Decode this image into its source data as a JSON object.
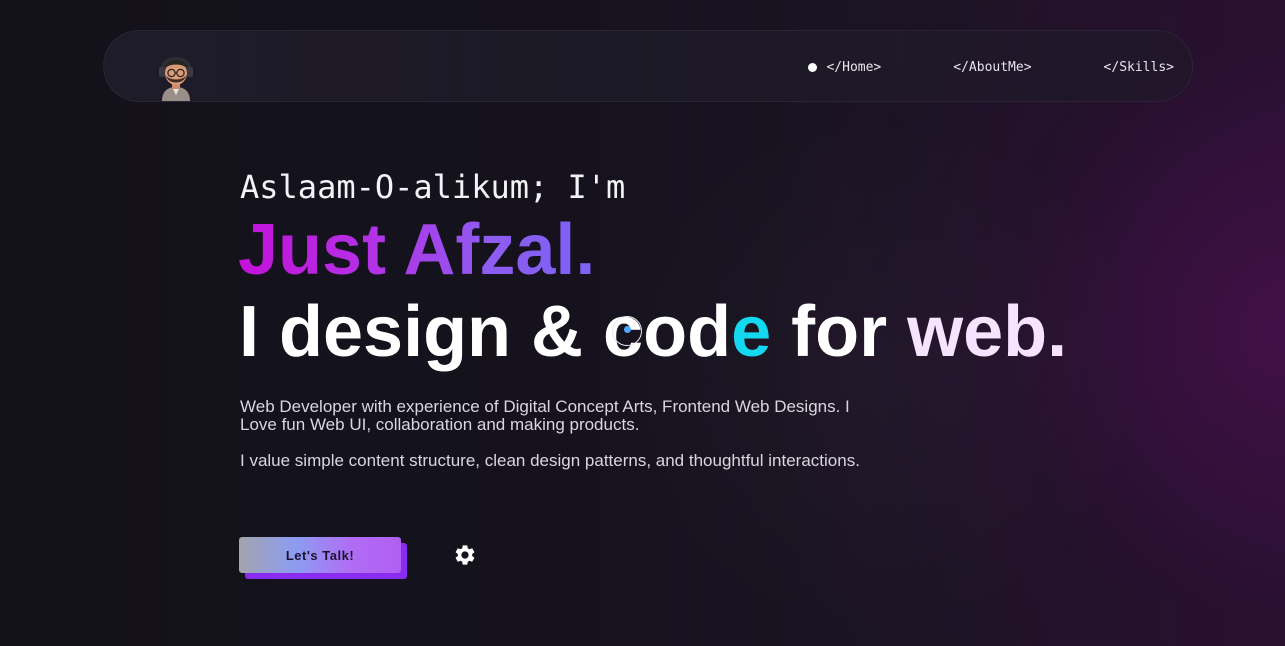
{
  "nav": {
    "links": [
      {
        "label": "</Home>",
        "active": true
      },
      {
        "label": "</AboutMe>",
        "active": false
      },
      {
        "label": "</Skills>",
        "active": false
      }
    ]
  },
  "hero": {
    "greeting": "Aslaam-O-alikum; I'm",
    "name": "Just Afzal.",
    "tagline": {
      "part1": "I design & co",
      "part2": "d",
      "highlight": "e",
      "part3": " for ",
      "part4": "web."
    },
    "description": [
      "Web Developer with experience of Digital Concept Arts, Frontend Web Designs. I Love fun Web UI, collaboration and making products.",
      "I value simple content structure, clean design patterns, and thoughtful interactions."
    ],
    "cta_label": "Let's Talk!"
  },
  "colors": {
    "accent_cyan": "#14d8f0",
    "accent_purple": "#b233e6",
    "background": "#14111c"
  },
  "icons": {
    "avatar": "avatar-icon",
    "settings": "gear-icon"
  }
}
